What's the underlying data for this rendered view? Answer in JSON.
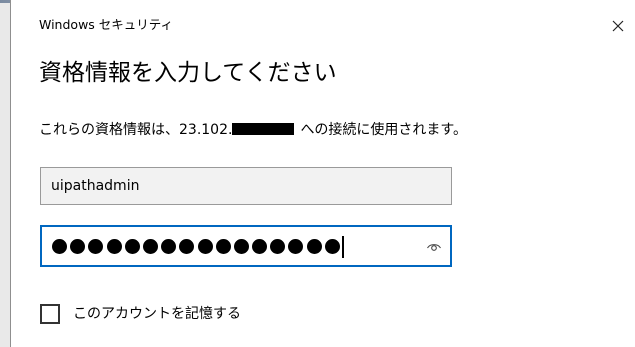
{
  "window": {
    "title": "Windows セキュリティ",
    "close_icon": "close-icon"
  },
  "dialog": {
    "heading": "資格情報を入力してください",
    "info_prefix": "これらの資格情報は、23.102.",
    "info_suffix": "への接続に使用されます。"
  },
  "username": {
    "value": "uipathadmin"
  },
  "password": {
    "masked_length": 16,
    "reveal_icon": "eye-icon",
    "focused": true
  },
  "remember": {
    "label": "このアカウントを記憶する",
    "checked": false
  },
  "colors": {
    "focus_border": "#0067c0",
    "field_background": "#f2f2f2"
  }
}
